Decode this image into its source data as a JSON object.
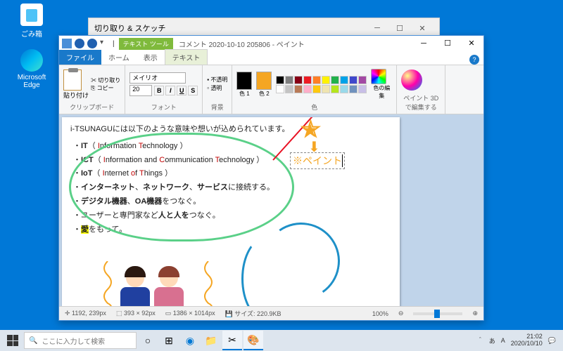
{
  "desktop": {
    "recycleBin": "ごみ箱",
    "edge": "Microsoft Edge"
  },
  "snip": {
    "title": "切り取り & スケッチ"
  },
  "paint": {
    "textTools": "テキスト ツール",
    "title": "コメント 2020-10-10 205806 - ペイント",
    "tabs": {
      "file": "ファイル",
      "home": "ホーム",
      "view": "表示",
      "text": "テキスト"
    },
    "ribbon": {
      "clipboard": "クリップボード",
      "paste": "貼り付け",
      "cut": "切り取り",
      "copy": "コピー",
      "font": "フォント",
      "fontName": "メイリオ",
      "fontSize": "20",
      "opaque": "不透明",
      "transparent": "透明",
      "background": "背景",
      "color1": "色 1",
      "color2": "色 2",
      "colors": "色",
      "editColors": "色の編集",
      "paint3d": "ペイント 3D で編集する"
    },
    "status": {
      "cursor": "1192, 239px",
      "selection": "393 × 92px",
      "canvas": "1386 × 1014px",
      "size": "サイズ: 220.9KB",
      "zoom": "100%"
    }
  },
  "doc": {
    "heading": "i-TSUNAGUには以下のような意味や想いが込められています。",
    "it_b": "IT",
    "it_p1": "（ ",
    "it_i": "I",
    "it_r1": "nformation ",
    "it_t": "T",
    "it_r2": "echnology ）",
    "ict_b": "ICT",
    "ict_p": "（ ",
    "ict_i": "I",
    "ict_r1": "nformation and ",
    "ict_c": "C",
    "ict_r2": "ommunication ",
    "ict_t": "T",
    "ict_r3": "echnology ）",
    "iot_b": "IoT",
    "iot_p": "（ ",
    "iot_i": "I",
    "iot_r1": "nternet ",
    "iot_o": "o",
    "iot_r2": "f ",
    "iot_t": "T",
    "iot_r3": "hings ）",
    "l4a": "インターネット",
    "l4b": "ネットワーク",
    "l4c": "サービス",
    "l4d": "に接続する。",
    "l5a": "デジタル機器",
    "l5b": "OA機器",
    "l5c": "をつなぐ。",
    "l6a": "ユーザーと専門家など",
    "l6b": "人と人を",
    "l6c": "つなぐ。",
    "l7a": "愛",
    "l7b": "をもって。",
    "textbox": "※ペイント"
  },
  "taskbar": {
    "search": "ここに入力して検索"
  },
  "tray": {
    "ime1": "あ",
    "ime2": "A",
    "time": "21:02",
    "date": "2020/10/10"
  },
  "palette": [
    "#000",
    "#7f7f7f",
    "#880015",
    "#ed1c24",
    "#ff7f27",
    "#fff200",
    "#22b14c",
    "#00a2e8",
    "#3f48cc",
    "#a349a4",
    "#fff",
    "#c3c3c3",
    "#b97a57",
    "#ffaec9",
    "#ffc90e",
    "#efe4b0",
    "#b5e61d",
    "#99d9ea",
    "#7092be",
    "#c8bfe7"
  ]
}
